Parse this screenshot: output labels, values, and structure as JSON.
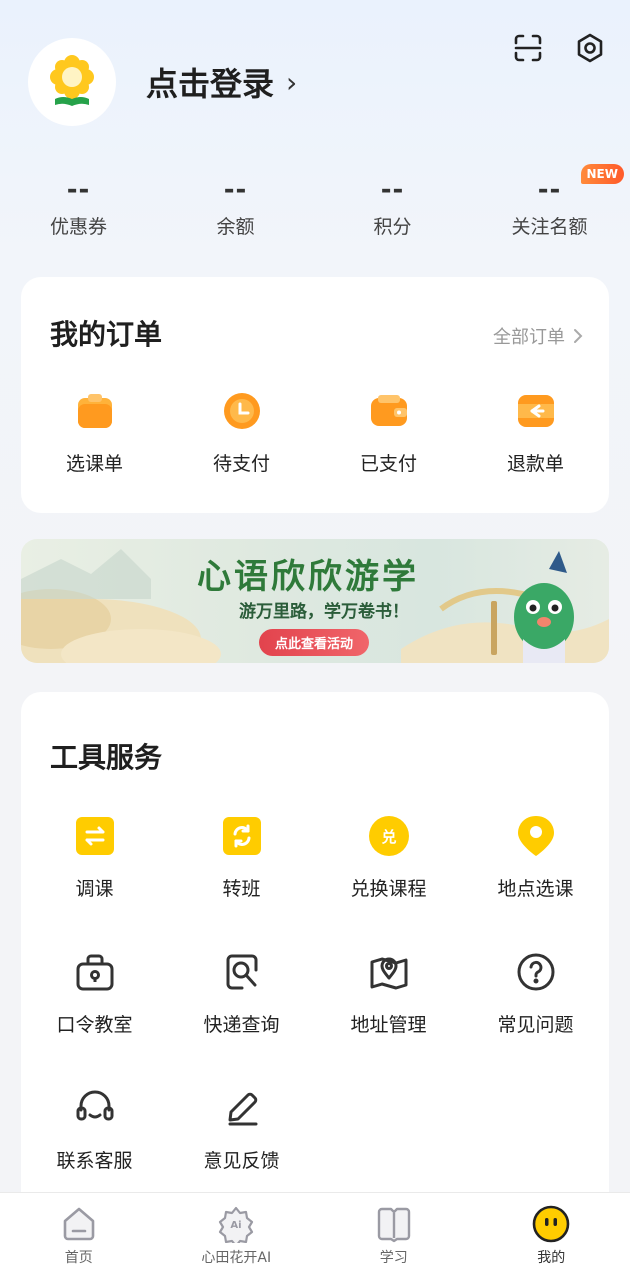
{
  "profile": {
    "login_label": "点击登录",
    "chevron": "›"
  },
  "header_icons": [
    "scan-icon",
    "settings-icon"
  ],
  "stats": [
    {
      "value": "--",
      "label": "优惠券"
    },
    {
      "value": "--",
      "label": "余额"
    },
    {
      "value": "--",
      "label": "积分"
    },
    {
      "value": "--",
      "label": "关注名额",
      "badge": "NEW"
    }
  ],
  "orders": {
    "title": "我的订单",
    "all_label": "全部订单",
    "items": [
      {
        "label": "选课单",
        "icon": "bag-icon"
      },
      {
        "label": "待支付",
        "icon": "clock-icon"
      },
      {
        "label": "已支付",
        "icon": "wallet-icon"
      },
      {
        "label": "退款单",
        "icon": "refund-icon"
      }
    ]
  },
  "banner": {
    "title": "心语欣欣游学",
    "subtitle": "游万里路，学万卷书！",
    "button": "点此查看活动"
  },
  "tools": {
    "title": "工具服务",
    "items": [
      {
        "label": "调课",
        "icon": "swap-icon"
      },
      {
        "label": "转班",
        "icon": "transfer-icon"
      },
      {
        "label": "兑换课程",
        "icon": "redeem-icon"
      },
      {
        "label": "地点选课",
        "icon": "location-icon"
      },
      {
        "label": "口令教室",
        "icon": "lock-bag-icon"
      },
      {
        "label": "快递查询",
        "icon": "search-doc-icon"
      },
      {
        "label": "地址管理",
        "icon": "map-pin-icon"
      },
      {
        "label": "常见问题",
        "icon": "question-icon"
      },
      {
        "label": "联系客服",
        "icon": "headset-icon"
      },
      {
        "label": "意见反馈",
        "icon": "pen-icon"
      }
    ]
  },
  "tabs": [
    {
      "label": "首页",
      "icon": "home-icon"
    },
    {
      "label": "心田花开AI",
      "icon": "ai-flower-icon"
    },
    {
      "label": "学习",
      "icon": "book-icon"
    },
    {
      "label": "我的",
      "icon": "face-icon",
      "active": true
    }
  ],
  "colors": {
    "accent": "#ffcc00",
    "orange": "#ff9a1f",
    "badge": "#ff6a2e",
    "danger": "#e2434d"
  }
}
